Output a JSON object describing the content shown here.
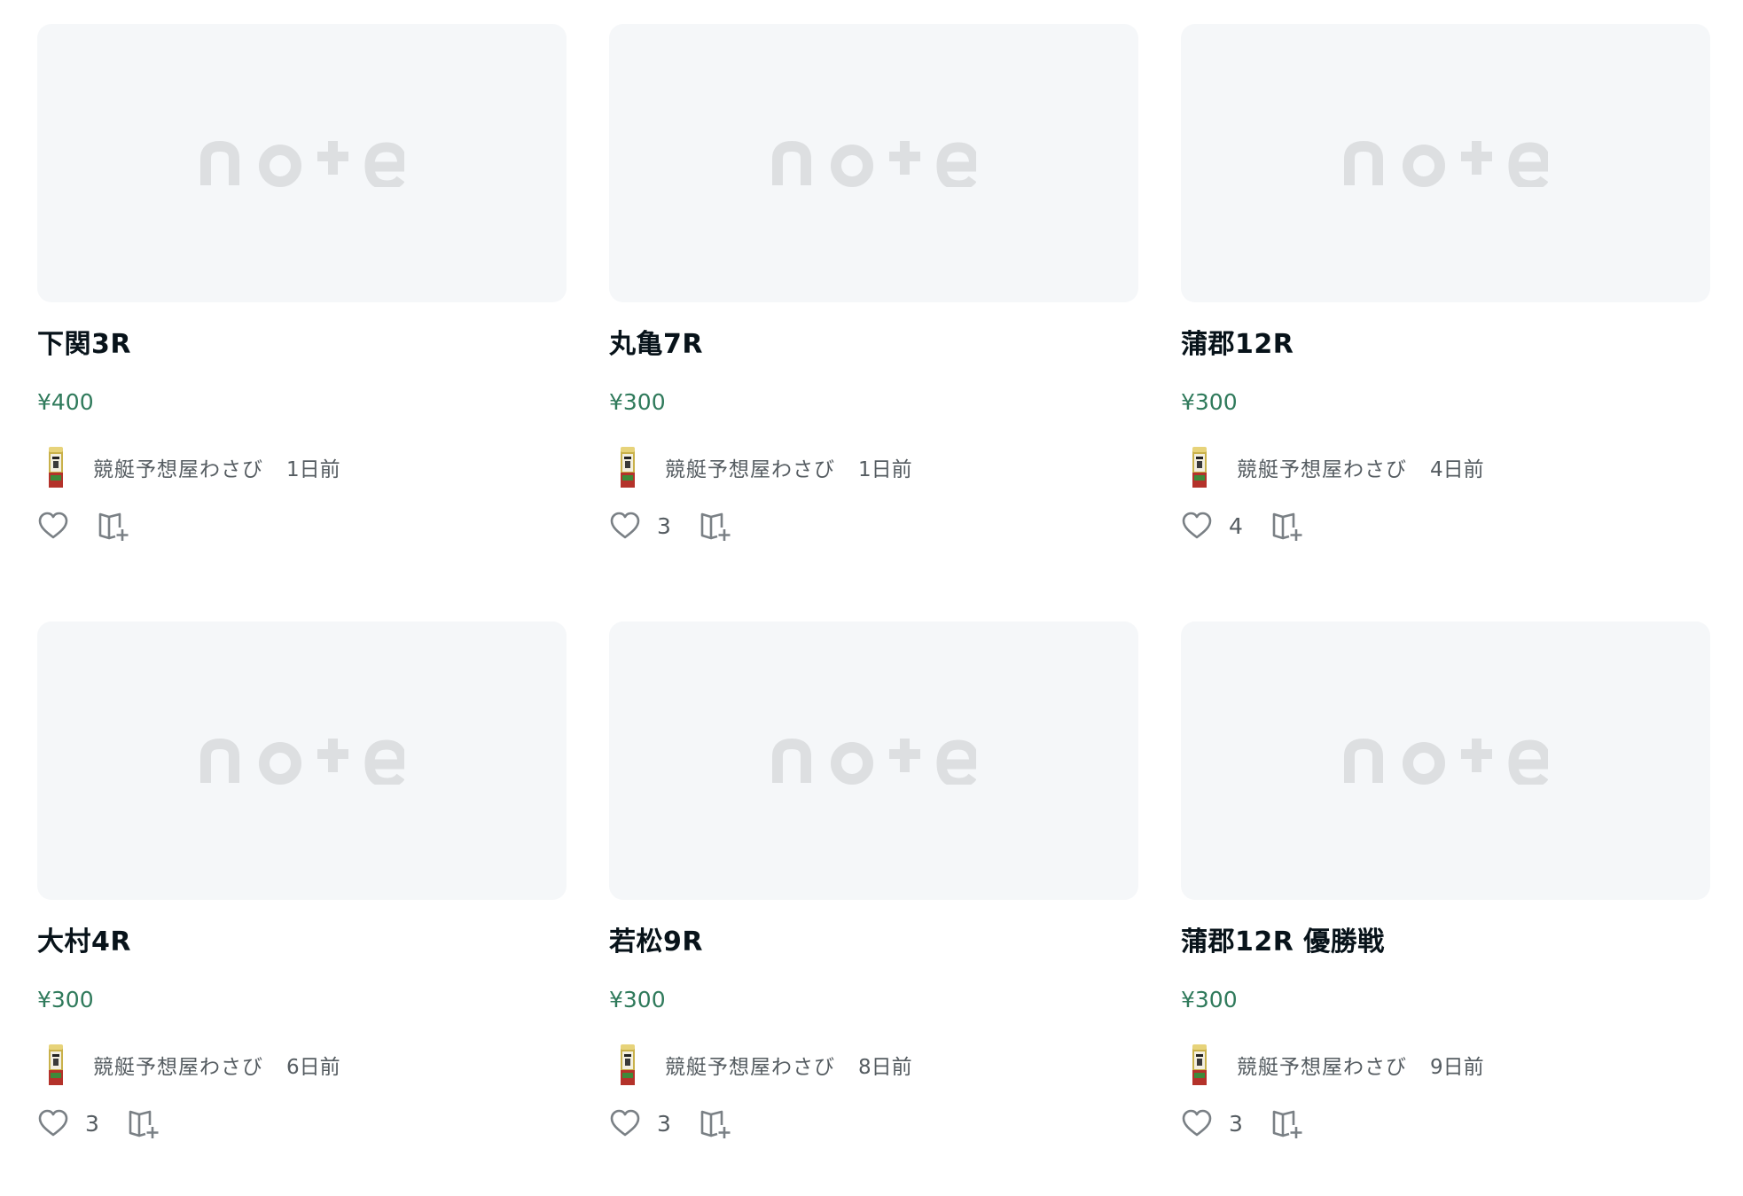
{
  "placeholder_logo_text": "note",
  "colors": {
    "thumb_bg": "#f5f7f9",
    "logo": "#dddfe1",
    "price": "#2f7a5b",
    "meta": "#555c61",
    "icon": "#7a8085"
  },
  "cards": [
    {
      "title": "下関3R",
      "price": "¥400",
      "author": "競艇予想屋わさび",
      "date": "1日前",
      "likes": "",
      "icons": {
        "like": "heart-icon",
        "save": "magazine-add-icon"
      }
    },
    {
      "title": "丸亀7R",
      "price": "¥300",
      "author": "競艇予想屋わさび",
      "date": "1日前",
      "likes": "3",
      "icons": {
        "like": "heart-icon",
        "save": "magazine-add-icon"
      }
    },
    {
      "title": "蒲郡12R",
      "price": "¥300",
      "author": "競艇予想屋わさび",
      "date": "4日前",
      "likes": "4",
      "icons": {
        "like": "heart-icon",
        "save": "magazine-add-icon"
      }
    },
    {
      "title": "大村4R",
      "price": "¥300",
      "author": "競艇予想屋わさび",
      "date": "6日前",
      "likes": "3",
      "icons": {
        "like": "heart-icon",
        "save": "magazine-add-icon"
      }
    },
    {
      "title": "若松9R",
      "price": "¥300",
      "author": "競艇予想屋わさび",
      "date": "8日前",
      "likes": "3",
      "icons": {
        "like": "heart-icon",
        "save": "magazine-add-icon"
      }
    },
    {
      "title": "蒲郡12R 優勝戦",
      "price": "¥300",
      "author": "競艇予想屋わさび",
      "date": "9日前",
      "likes": "3",
      "icons": {
        "like": "heart-icon",
        "save": "magazine-add-icon"
      }
    }
  ]
}
